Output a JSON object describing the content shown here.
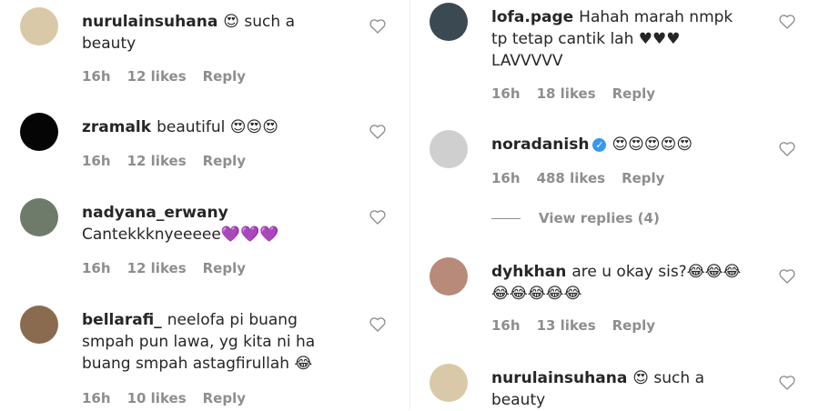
{
  "left": [
    {
      "username": "nurulainsuhana",
      "text": "😍 such a beauty",
      "time": "16h",
      "likes": "12 likes",
      "reply": "Reply",
      "avatar": "#d9c9a8"
    },
    {
      "username": "zramalk",
      "text": "beautiful 😍😍😍",
      "time": "16h",
      "likes": "12 likes",
      "reply": "Reply",
      "avatar": "#050505"
    },
    {
      "username": "nadyana_erwany",
      "text": "Cantekkknyeeeee💜💜💜",
      "time": "16h",
      "likes": "12 likes",
      "reply": "Reply",
      "avatar": "#6e7b6a"
    },
    {
      "username": "bellarafi_",
      "text": "neelofa pi buang smpah pun lawa, yg kita ni ha buang smpah astagfirullah 😂",
      "time": "16h",
      "likes": "10 likes",
      "reply": "Reply",
      "avatar": "#8a6b4f"
    }
  ],
  "right": [
    {
      "username": "lofa.page",
      "text": "Hahah marah nmpk tp tetap cantik lah ♥♥♥ LAVVVVV",
      "time": "16h",
      "likes": "18 likes",
      "reply": "Reply",
      "avatar": "#3b4a52"
    },
    {
      "username": "noradanish",
      "verified": "✓",
      "text": "😍😍😍😍😍",
      "time": "16h",
      "likes": "488 likes",
      "reply": "Reply",
      "view_replies": "View replies (4)",
      "avatar": "#cfcfcf"
    },
    {
      "username": "dyhkhan",
      "text": "are u okay sis?😂😂😂😂😂😂😂😂",
      "time": "16h",
      "likes": "13 likes",
      "reply": "Reply",
      "avatar": "#b88a7a"
    },
    {
      "username": "nurulainsuhana",
      "text": "😍 such a beauty",
      "avatar": "#d9c9a8"
    }
  ],
  "icons": {
    "like": "heart-outline-icon",
    "verified": "verified-badge-icon"
  },
  "colors": {
    "text": "#262626",
    "meta": "#8e8e8e",
    "verified": "#3897f0"
  }
}
